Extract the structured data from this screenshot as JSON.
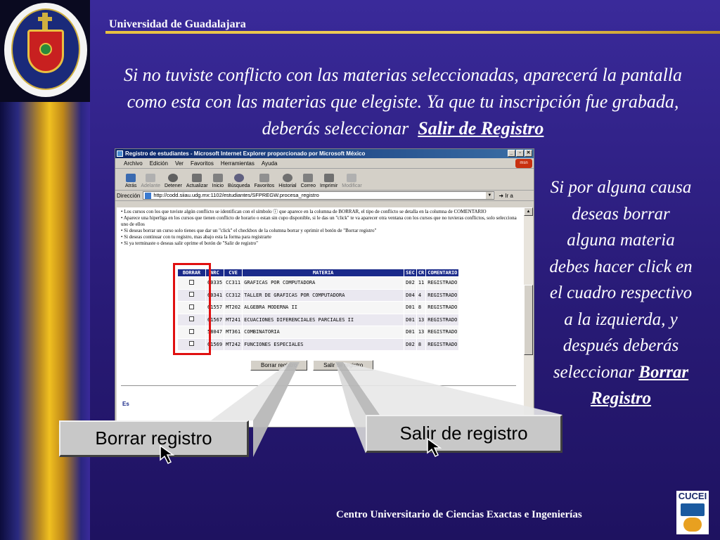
{
  "slide": {
    "university": "Universidad de Guadalajara",
    "main_text": "Si no tuviste conflicto con las materias seleccionadas, aparecerá la pantalla como esta con las materias que elegiste. Ya que tu inscripción fue grabada, deberás seleccionar",
    "main_link": "Salir de Registro",
    "side_text": "Si por alguna causa deseas borrar alguna materia debes hacer click en el cuadro respectivo a la izquierda, y después deberás seleccionar",
    "side_link": "Borrar Registro",
    "footer": "Centro Universitario de Ciencias Exactas e Ingenierías",
    "cucei_logo": "CUCEI"
  },
  "browser": {
    "title": "Registro de estudiantes - Microsoft Internet Explorer proporcionado por Microsoft México",
    "menu": [
      "Archivo",
      "Edición",
      "Ver",
      "Favoritos",
      "Herramientas",
      "Ayuda"
    ],
    "toolbar": [
      {
        "label": "Atrás",
        "icon": "back-arrow-icon",
        "enabled": true
      },
      {
        "label": "Adelante",
        "icon": "forward-arrow-icon",
        "enabled": false
      },
      {
        "label": "Detener",
        "icon": "stop-icon",
        "enabled": true
      },
      {
        "label": "Actualizar",
        "icon": "refresh-icon",
        "enabled": true
      },
      {
        "label": "Inicio",
        "icon": "home-icon",
        "enabled": true
      },
      {
        "label": "Búsqueda",
        "icon": "search-icon",
        "enabled": true
      },
      {
        "label": "Favoritos",
        "icon": "favorites-icon",
        "enabled": true
      },
      {
        "label": "Historial",
        "icon": "history-icon",
        "enabled": true
      },
      {
        "label": "Correo",
        "icon": "mail-icon",
        "enabled": true
      },
      {
        "label": "Imprimir",
        "icon": "print-icon",
        "enabled": true
      },
      {
        "label": "Modificar",
        "icon": "edit-icon",
        "enabled": false
      }
    ],
    "address_label": "Dirección",
    "url": "http://codd.siiau.udg.mx:1102/estudiantes/SFPREGW.procesa_registro",
    "go_label": "Ir a"
  },
  "page": {
    "instructions": [
      "Los cursos con los que tuviste algún conflicto se identifican con el símbolo ⓘ que aparece en la columna de BORRAR, el tipo de conflicto se detalla en la columna de COMENTARIO",
      "Aparece una hiperliga en los cursos que tienen conflicto de horario o estan sin cupo disponible, si le das un \"click\" te va aparecer otra ventana con los cursos que no tuvieras conflictos, solo selecciona uno de ellos",
      "Si deseas borrar un curso solo tienes que dar un \"click\" el checkbox de la columna borrar y oprimir el botón de \"Borrar registro\"",
      "Si deseas continuar con tu registro, mas abajo esta la forma para registrarte",
      "Si ya terminaste o deseas salir oprime el botón de \"Salir de registro\""
    ],
    "table_headers": [
      "BORRAR",
      "NRC",
      "CVE",
      "MATERIA",
      "SEC",
      "CR",
      "COMENTARIO"
    ],
    "rows": [
      {
        "nrc": "60335",
        "cve": "CC311",
        "materia": "GRAFICAS POR COMPUTADORA",
        "sec": "D02",
        "cr": "11",
        "comentario": "REGISTRADO"
      },
      {
        "nrc": "60341",
        "cve": "CC312",
        "materia": "TALLER DE GRAFICAS POR COMPUTADORA",
        "sec": "D04",
        "cr": "4",
        "comentario": "REGISTRADO"
      },
      {
        "nrc": "61557",
        "cve": "MT202",
        "materia": "ALGEBRA MODERNA II",
        "sec": "D01",
        "cr": "8",
        "comentario": "REGISTRADO"
      },
      {
        "nrc": "61567",
        "cve": "MT241",
        "materia": "ECUACIONES DIFERENCIALES PARCIALES II",
        "sec": "D01",
        "cr": "13",
        "comentario": "REGISTRADO"
      },
      {
        "nrc": "58047",
        "cve": "MT361",
        "materia": "COMBINATORIA",
        "sec": "D01",
        "cr": "13",
        "comentario": "REGISTRADO"
      },
      {
        "nrc": "61569",
        "cve": "MT242",
        "materia": "FUNCIONES ESPECIALES",
        "sec": "D02",
        "cr": "8",
        "comentario": "REGISTRADO"
      }
    ],
    "borrar_button": "Borrar registro",
    "salir_button": "Salir de registro",
    "truncated_heading": "Es"
  },
  "callouts": {
    "borrar": "Borrar registro",
    "salir": "Salir de registro"
  }
}
